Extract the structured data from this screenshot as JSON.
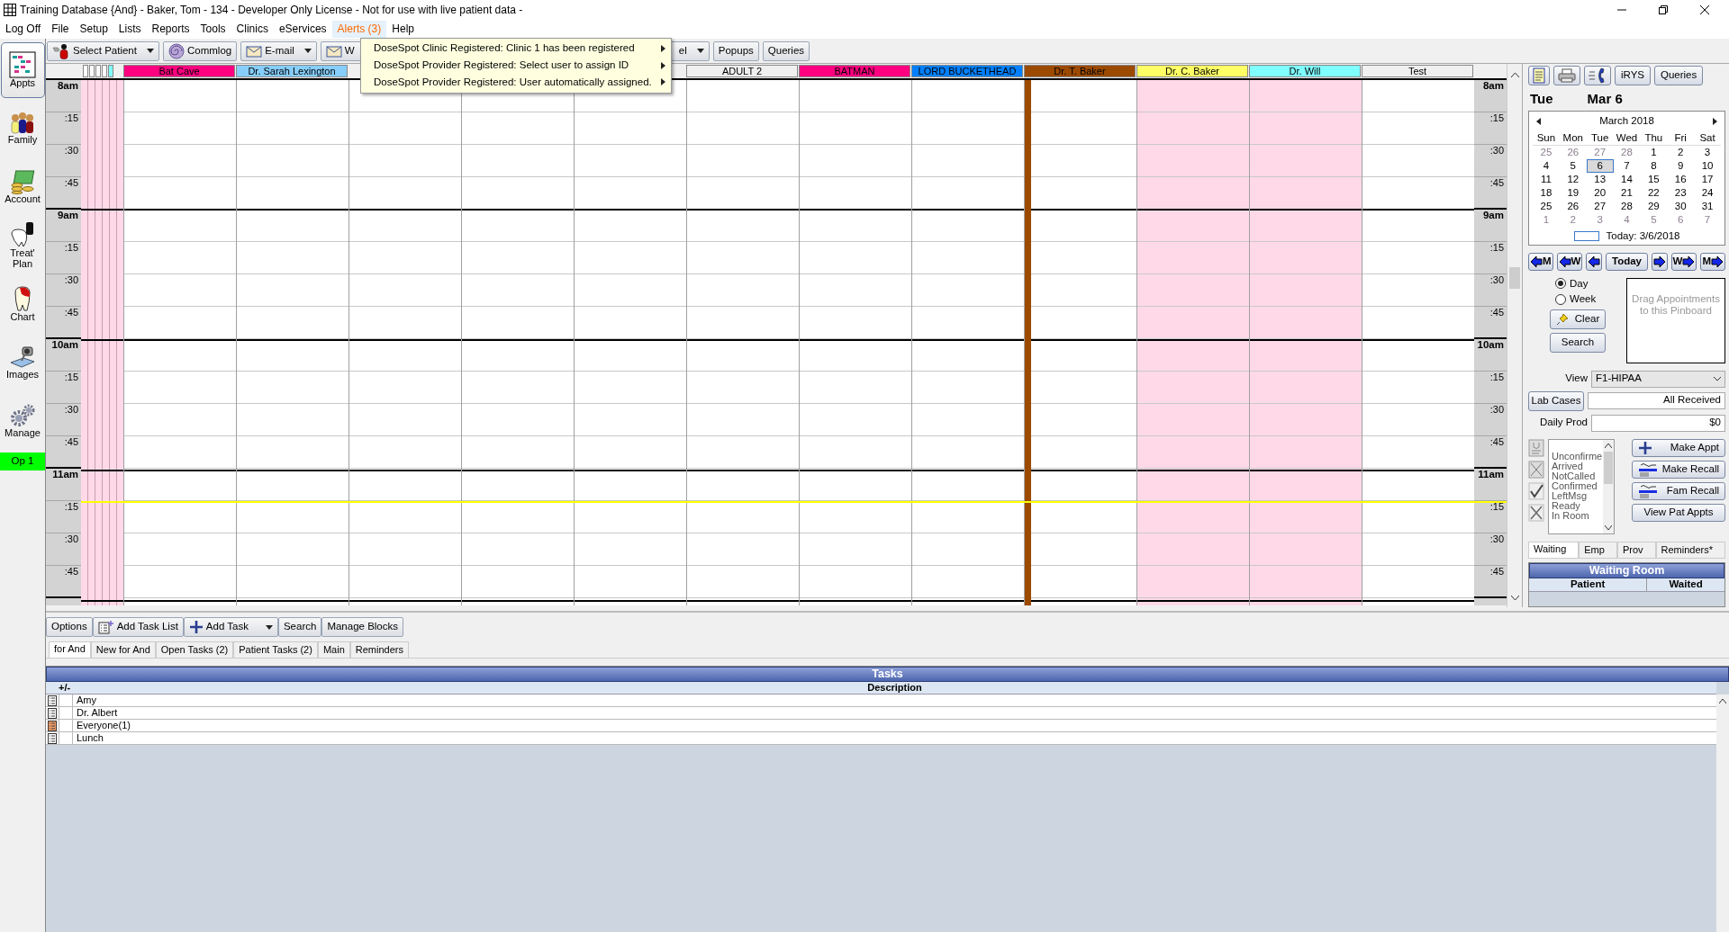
{
  "window": {
    "title": "Training Database {And} - Baker, Tom - 134 - Developer Only License - Not for use with live patient data -"
  },
  "menu": [
    {
      "label": "Log Off",
      "kind": "plain",
      "open": false
    },
    {
      "label": "File",
      "kind": "plain",
      "open": false
    },
    {
      "label": "Setup",
      "kind": "plain",
      "open": false
    },
    {
      "label": "Lists",
      "kind": "plain",
      "open": false
    },
    {
      "label": "Reports",
      "kind": "plain",
      "open": false
    },
    {
      "label": "Tools",
      "kind": "plain",
      "open": false
    },
    {
      "label": "Clinics",
      "kind": "plain",
      "open": false
    },
    {
      "label": "eServices",
      "kind": "plain",
      "open": false
    },
    {
      "label": "Alerts (3)",
      "kind": "alert",
      "open": true
    },
    {
      "label": "Help",
      "kind": "plain",
      "open": false
    }
  ],
  "alert_menu": [
    {
      "label": "DoseSpot Clinic Registered: Clinic 1 has been registered",
      "submenu": true
    },
    {
      "label": "DoseSpot Provider Registered: Select user to assign ID",
      "submenu": true
    },
    {
      "label": "DoseSpot Provider Registered: User automatically assigned.",
      "submenu": true
    }
  ],
  "toolbar": [
    {
      "label": "Select Patient",
      "kind": "patient",
      "dropdown": true
    },
    {
      "label": "Commlog",
      "kind": "commlog",
      "dropdown": false
    },
    {
      "label": "E-mail",
      "kind": "email",
      "dropdown": true
    },
    {
      "label": "W",
      "kind": "email"
    },
    {
      "label": "el",
      "kind": "plain",
      "dropdown": true
    },
    {
      "label": "Popups",
      "kind": "plain",
      "dropdown": false
    },
    {
      "label": "Queries",
      "kind": "plain",
      "dropdown": false
    }
  ],
  "sidebar": {
    "modules": [
      {
        "label": "Appts",
        "kind": "appts",
        "selected": true
      },
      {
        "label": "Family",
        "kind": "family",
        "selected": false
      },
      {
        "label": "Account",
        "kind": "account",
        "selected": false
      },
      {
        "label": "Treat' Plan",
        "kind": "treat",
        "selected": false
      },
      {
        "label": "Chart",
        "kind": "chart",
        "selected": false
      },
      {
        "label": "Images",
        "kind": "images",
        "selected": false
      },
      {
        "label": "Manage",
        "kind": "manage",
        "selected": false
      }
    ],
    "operatory": "Op 1"
  },
  "schedule": {
    "columns": [
      {
        "label": "Bat Cave",
        "color": "#ff0080",
        "shaded": false,
        "provider_bar": false
      },
      {
        "label": "Dr. Sarah Lexington",
        "color": "#87cefa",
        "shaded": false,
        "provider_bar": false
      },
      {
        "shaded": false,
        "provider_bar": false
      },
      {
        "shaded": false,
        "provider_bar": false
      },
      {
        "shaded": false,
        "provider_bar": false
      },
      {
        "label": "ADULT 2",
        "color": "#f0f0f0",
        "shaded": false,
        "provider_bar": false
      },
      {
        "label": "BATMAN",
        "color": "#ff0080",
        "shaded": false,
        "provider_bar": false
      },
      {
        "label": "LORD BUCKETHEAD",
        "color": "#0080ff",
        "shaded": false,
        "provider_bar": false
      },
      {
        "label": "Dr. T. Baker",
        "color": "#9c4a00",
        "shaded": false,
        "provider_bar": true
      },
      {
        "label": "Dr. C. Baker",
        "color": "#ffff66",
        "shaded": true,
        "provider_bar": false
      },
      {
        "label": "Dr. Will",
        "color": "#80ffff",
        "shaded": true,
        "provider_bar": false
      },
      {
        "label": "Test",
        "color": "#f0f0f0",
        "shaded": false,
        "provider_bar": false
      }
    ],
    "left_times": [
      {
        "label": "8am",
        "kind": "hour",
        "now": false
      },
      {
        "label": ":15",
        "kind": "quarter",
        "now": false
      },
      {
        "label": ":30",
        "kind": "quarter",
        "now": false
      },
      {
        "label": ":45",
        "kind": "quarter",
        "now": false
      },
      {
        "label": "9am",
        "kind": "hour",
        "now": false
      },
      {
        "label": ":15",
        "kind": "quarter",
        "now": false
      },
      {
        "label": ":30",
        "kind": "quarter",
        "now": false
      },
      {
        "label": ":45",
        "kind": "quarter",
        "now": false
      },
      {
        "label": "10am",
        "kind": "hour",
        "now": false
      },
      {
        "label": ":15",
        "kind": "quarter",
        "now": false
      },
      {
        "label": ":30",
        "kind": "quarter",
        "now": false
      },
      {
        "label": ":45",
        "kind": "quarter",
        "now": false
      },
      {
        "label": "11am",
        "kind": "hour",
        "now": false
      },
      {
        "label": ":15",
        "kind": "quarter",
        "now": true
      },
      {
        "label": ":30",
        "kind": "quarter",
        "now": false
      },
      {
        "label": ":45",
        "kind": "quarter",
        "now": false
      }
    ],
    "right_times": [
      {
        "label": "8am",
        "kind": "hour"
      },
      {
        "label": ":15",
        "kind": "quarter"
      },
      {
        "label": ":30",
        "kind": "quarter"
      },
      {
        "label": ":45",
        "kind": "quarter"
      },
      {
        "label": "9am",
        "kind": "hour"
      },
      {
        "label": ":15",
        "kind": "quarter"
      },
      {
        "label": ":30",
        "kind": "quarter"
      },
      {
        "label": ":45",
        "kind": "quarter"
      },
      {
        "label": "10am",
        "kind": "hour"
      },
      {
        "label": ":15",
        "kind": "quarter"
      },
      {
        "label": ":30",
        "kind": "quarter"
      },
      {
        "label": ":45",
        "kind": "quarter"
      },
      {
        "label": "11am",
        "kind": "hour"
      },
      {
        "label": ":15",
        "kind": "quarter"
      },
      {
        "label": ":30",
        "kind": "quarter"
      },
      {
        "label": ":45",
        "kind": "quarter"
      }
    ]
  },
  "right_panel": {
    "buttons": [
      "iRYS",
      "Queries"
    ],
    "day_name": "Tue",
    "date": "Mar 6",
    "calendar": {
      "month": "March 2018",
      "weekdays": [
        "Sun",
        "Mon",
        "Tue",
        "Wed",
        "Thu",
        "Fri",
        "Sat"
      ],
      "weeks": [
        [
          {
            "day": "25",
            "muted": true,
            "selected": false
          },
          {
            "day": "26",
            "muted": true,
            "selected": false
          },
          {
            "day": "27",
            "muted": true,
            "selected": false
          },
          {
            "day": "28",
            "muted": true,
            "selected": false
          },
          {
            "day": "1",
            "muted": false,
            "selected": false
          },
          {
            "day": "2",
            "muted": false,
            "selected": false
          },
          {
            "day": "3",
            "muted": false,
            "selected": false
          }
        ],
        [
          {
            "day": "4",
            "muted": false,
            "selected": false
          },
          {
            "day": "5",
            "muted": false,
            "selected": false
          },
          {
            "day": "6",
            "muted": false,
            "selected": true
          },
          {
            "day": "7",
            "muted": false,
            "selected": false
          },
          {
            "day": "8",
            "muted": false,
            "selected": false
          },
          {
            "day": "9",
            "muted": false,
            "selected": false
          },
          {
            "day": "10",
            "muted": false,
            "selected": false
          }
        ],
        [
          {
            "day": "11",
            "muted": false,
            "selected": false
          },
          {
            "day": "12",
            "muted": false,
            "selected": false
          },
          {
            "day": "13",
            "muted": false,
            "selected": false
          },
          {
            "day": "14",
            "muted": false,
            "selected": false
          },
          {
            "day": "15",
            "muted": false,
            "selected": false
          },
          {
            "day": "16",
            "muted": false,
            "selected": false
          },
          {
            "day": "17",
            "muted": false,
            "selected": false
          }
        ],
        [
          {
            "day": "18",
            "muted": false,
            "selected": false
          },
          {
            "day": "19",
            "muted": false,
            "selected": false
          },
          {
            "day": "20",
            "muted": false,
            "selected": false
          },
          {
            "day": "21",
            "muted": false,
            "selected": false
          },
          {
            "day": "22",
            "muted": false,
            "selected": false
          },
          {
            "day": "23",
            "muted": false,
            "selected": false
          },
          {
            "day": "24",
            "muted": false,
            "selected": false
          }
        ],
        [
          {
            "day": "25",
            "muted": false,
            "selected": false
          },
          {
            "day": "26",
            "muted": false,
            "selected": false
          },
          {
            "day": "27",
            "muted": false,
            "selected": false
          },
          {
            "day": "28",
            "muted": false,
            "selected": false
          },
          {
            "day": "29",
            "muted": false,
            "selected": false
          },
          {
            "day": "30",
            "muted": false,
            "selected": false
          },
          {
            "day": "31",
            "muted": false,
            "selected": false
          }
        ],
        [
          {
            "day": "1",
            "muted": true,
            "selected": false
          },
          {
            "day": "2",
            "muted": true,
            "selected": false
          },
          {
            "day": "3",
            "muted": true,
            "selected": false
          },
          {
            "day": "4",
            "muted": true,
            "selected": false
          },
          {
            "day": "5",
            "muted": true,
            "selected": false
          },
          {
            "day": "6",
            "muted": true,
            "selected": false
          },
          {
            "day": "7",
            "muted": true,
            "selected": false
          }
        ]
      ],
      "today": "Today: 3/6/2018"
    },
    "nav": [
      {
        "label": "M",
        "kind": "back"
      },
      {
        "label": "W",
        "kind": "back"
      },
      {
        "kind": "back"
      },
      {
        "label": "Today",
        "kind": "plain"
      },
      {
        "kind": "forward"
      },
      {
        "label": "W",
        "kind": "forward"
      },
      {
        "label": "M",
        "kind": "forward"
      }
    ],
    "view_mode": [
      {
        "label": "Day",
        "selected": true
      },
      {
        "label": "Week",
        "selected": false
      }
    ],
    "clear_button": "Clear",
    "search_button": "Search",
    "pinboard": "Drag Appointments to this Pinboard",
    "view": {
      "label": "View",
      "value": "F1-HIPAA"
    },
    "lab_cases": {
      "button": "Lab Cases",
      "value": "All Received"
    },
    "daily_prod": {
      "label": "Daily Prod",
      "value": "$0"
    },
    "statuses": [
      "Unconfirme",
      "Arrived",
      "NotCalled",
      "Confirmed",
      "LeftMsg",
      "Ready",
      "In Room"
    ],
    "actions": [
      {
        "label": "Make Appt",
        "kind": "plus"
      },
      {
        "label": "Make Recall",
        "kind": "recall"
      },
      {
        "label": "Fam Recall",
        "kind": "recall"
      },
      {
        "label": "View Pat Appts",
        "kind": "plain"
      }
    ],
    "tabs": [
      {
        "label": "Waiting",
        "selected": true
      },
      {
        "label": "Emp",
        "selected": false
      },
      {
        "label": "Prov",
        "selected": false
      },
      {
        "label": "Reminders*",
        "selected": false
      }
    ],
    "waiting_room": {
      "title": "Waiting Room",
      "columns": [
        "Patient",
        "Waited"
      ]
    }
  },
  "task_toolbar": [
    {
      "label": "Options",
      "kind": "plain",
      "dropdown": false
    },
    {
      "label": "Add Task List",
      "kind": "tasklist",
      "dropdown": false
    },
    {
      "label": "Add Task",
      "kind": "plus",
      "dropdown": true
    },
    {
      "label": "Search",
      "kind": "plain",
      "dropdown": false
    },
    {
      "label": "Manage Blocks",
      "kind": "plain",
      "dropdown": false
    }
  ],
  "task_tabs": [
    {
      "label": "for And",
      "selected": true
    },
    {
      "label": "New for And",
      "selected": false
    },
    {
      "label": "Open Tasks (2)",
      "selected": false
    },
    {
      "label": "Patient Tasks (2)",
      "selected": false
    },
    {
      "label": "Main",
      "selected": false
    },
    {
      "label": "Reminders",
      "selected": false
    }
  ],
  "tasks": {
    "title": "Tasks",
    "columns": [
      "+/-",
      "Description"
    ],
    "rows": [
      {
        "description": "Amy",
        "has_new": false
      },
      {
        "description": "Dr. Albert",
        "has_new": false
      },
      {
        "description": "Everyone(1)",
        "has_new": true
      },
      {
        "description": "Lunch",
        "has_new": false
      }
    ]
  }
}
